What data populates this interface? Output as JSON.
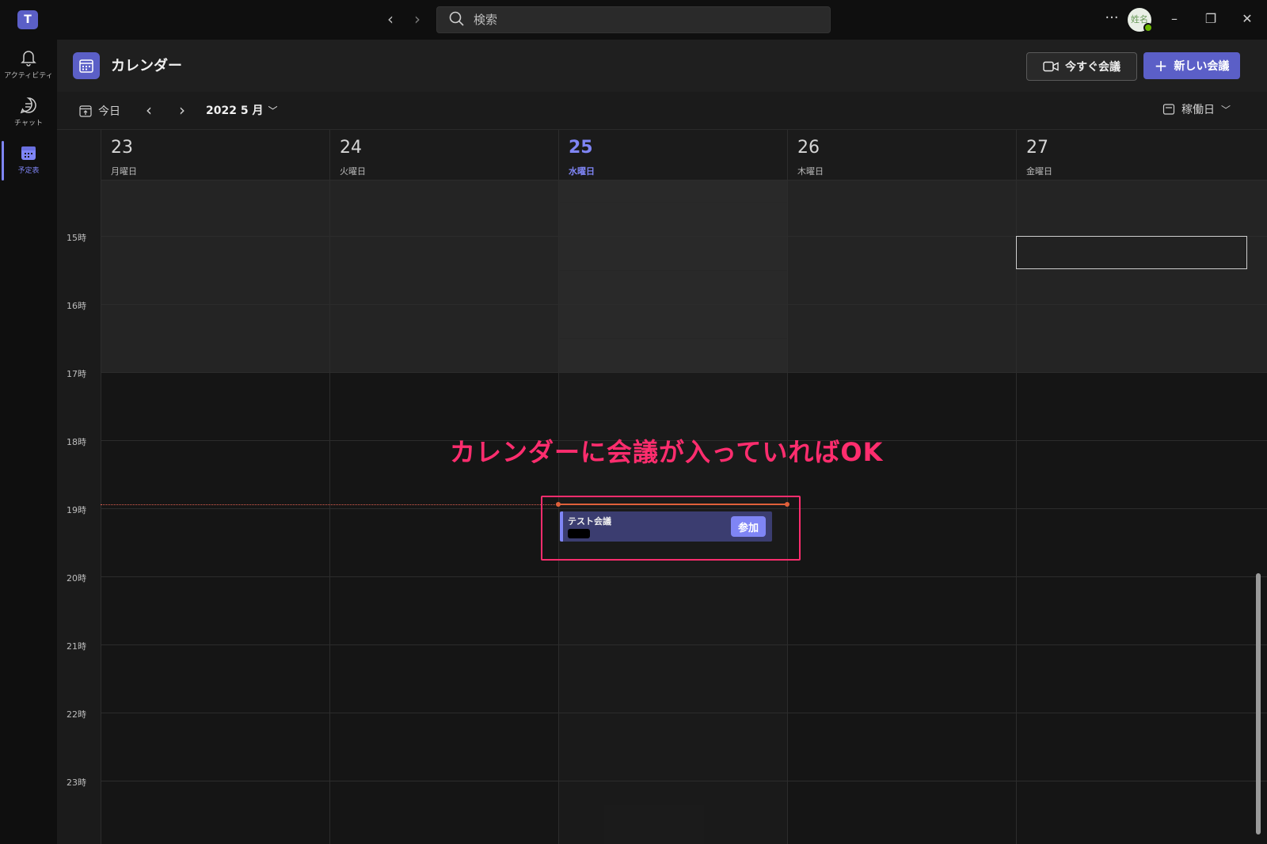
{
  "app": {
    "logo_text": "T"
  },
  "titlebar": {
    "search_placeholder": "検索",
    "more_label": "···",
    "avatar_text": "姓名"
  },
  "rail": {
    "items": [
      {
        "label": "アクティビティ",
        "icon": "bell-icon"
      },
      {
        "label": "チャット",
        "icon": "chat-icon"
      },
      {
        "label": "予定表",
        "icon": "calendar-icon",
        "active": true
      }
    ]
  },
  "header": {
    "title": "カレンダー",
    "meet_now_label": "今すぐ会議",
    "new_meeting_label": "新しい会議"
  },
  "toolbar": {
    "today_label": "今日",
    "month_label": "2022 5 月",
    "view_label": "稼働日"
  },
  "days": [
    {
      "num": "23",
      "name": "月曜日"
    },
    {
      "num": "24",
      "name": "火曜日"
    },
    {
      "num": "25",
      "name": "水曜日",
      "today": true
    },
    {
      "num": "26",
      "name": "木曜日"
    },
    {
      "num": "27",
      "name": "金曜日"
    }
  ],
  "hours": [
    "15時",
    "16時",
    "17時",
    "18時",
    "19時",
    "20時",
    "21時",
    "22時",
    "23時"
  ],
  "event": {
    "title": "テスト会議",
    "join_label": "参加",
    "color": "#7f85f5"
  },
  "annotation": {
    "text": "カレンダーに会議が入っていればOK",
    "color": "#ff2d6e"
  },
  "colors": {
    "accent": "#5b5fc7",
    "now_line": "#e0603a"
  }
}
